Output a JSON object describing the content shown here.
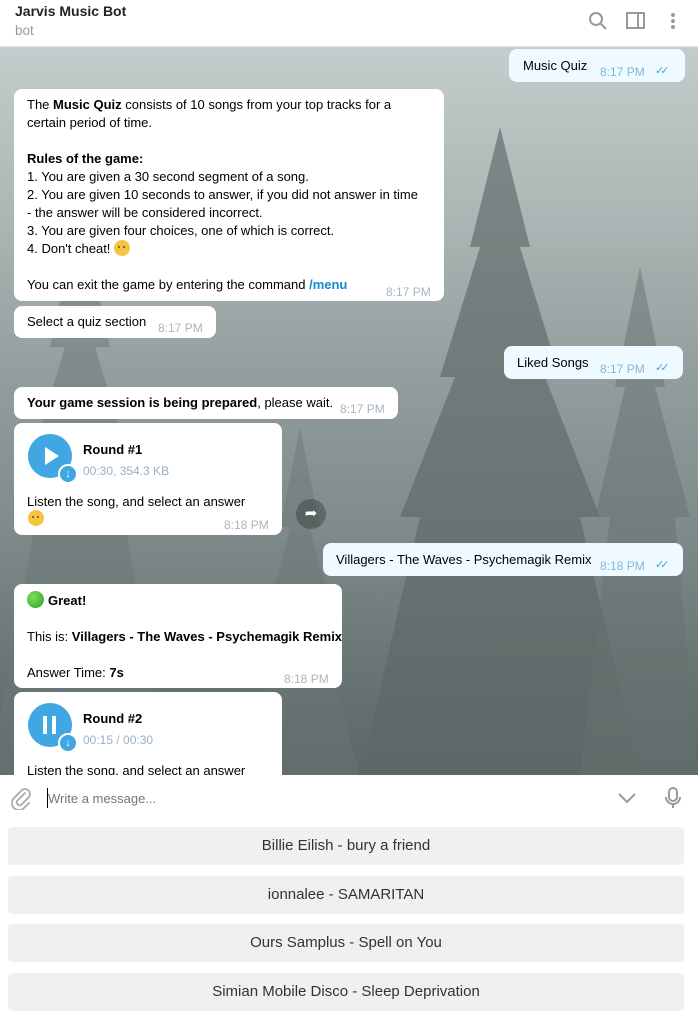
{
  "header": {
    "title": "Jarvis Music Bot",
    "subtitle": "bot"
  },
  "icons": {
    "search": "search-icon",
    "sidebar": "sidebar-toggle-icon",
    "menu": "more-vertical-icon",
    "attach": "paperclip-icon",
    "keyboard": "chevron-down-icon",
    "mic": "microphone-icon",
    "share": "share-icon"
  },
  "messages": {
    "m1": {
      "text": "Music Quiz",
      "time": "8:17 PM"
    },
    "m2": {
      "intro_pre": "The ",
      "intro_bold": "Music Quiz",
      "intro_post": " consists of 10 songs from your top tracks for a",
      "intro_line2": "certain period of time.",
      "rules_title": "Rules of the game:",
      "rule1": "1. You are given a 30 second segment of a song.",
      "rule2a": "2. You are given 10 seconds to answer, if you did not answer in time",
      "rule2b": "- the answer will be considered incorrect.",
      "rule3": "3. You are given four choices, one of which is correct.",
      "rule4": "4. Don't cheat!",
      "exit_pre": "You can exit the game by entering the command ",
      "exit_cmd": "/menu",
      "time": "8:17 PM"
    },
    "m3": {
      "text": "Select a quiz section",
      "time": "8:17 PM"
    },
    "m4": {
      "text": "Liked Songs",
      "time": "8:17 PM"
    },
    "m5": {
      "bold": "Your game session is being prepared",
      "rest": ", please wait.",
      "time": "8:17 PM"
    },
    "m6": {
      "title": "Round #1",
      "meta": "00:30, 354.3 KB",
      "caption": "Listen the song, and select an answer",
      "time": "8:18 PM"
    },
    "m7": {
      "text": "Villagers - The Waves - Psychemagik Remix",
      "time": "8:18 PM"
    },
    "m8": {
      "great": "Great!",
      "this_is": "This is: ",
      "song": "Villagers - The Waves - Psychemagik Remix",
      "answer_label": "Answer Time: ",
      "answer_value": "7s",
      "time": "8:18 PM"
    },
    "m9": {
      "title": "Round #2",
      "meta": "00:15 / 00:30",
      "caption": "Listen the song, and select an answer"
    }
  },
  "composer": {
    "placeholder": "Write a message..."
  },
  "keyboard": {
    "options": [
      "Billie Eilish - bury a friend",
      "ionnalee - SAMARITAN",
      "Ours Samplus - Spell on You",
      "Simian Mobile Disco - Sleep Deprivation"
    ]
  }
}
